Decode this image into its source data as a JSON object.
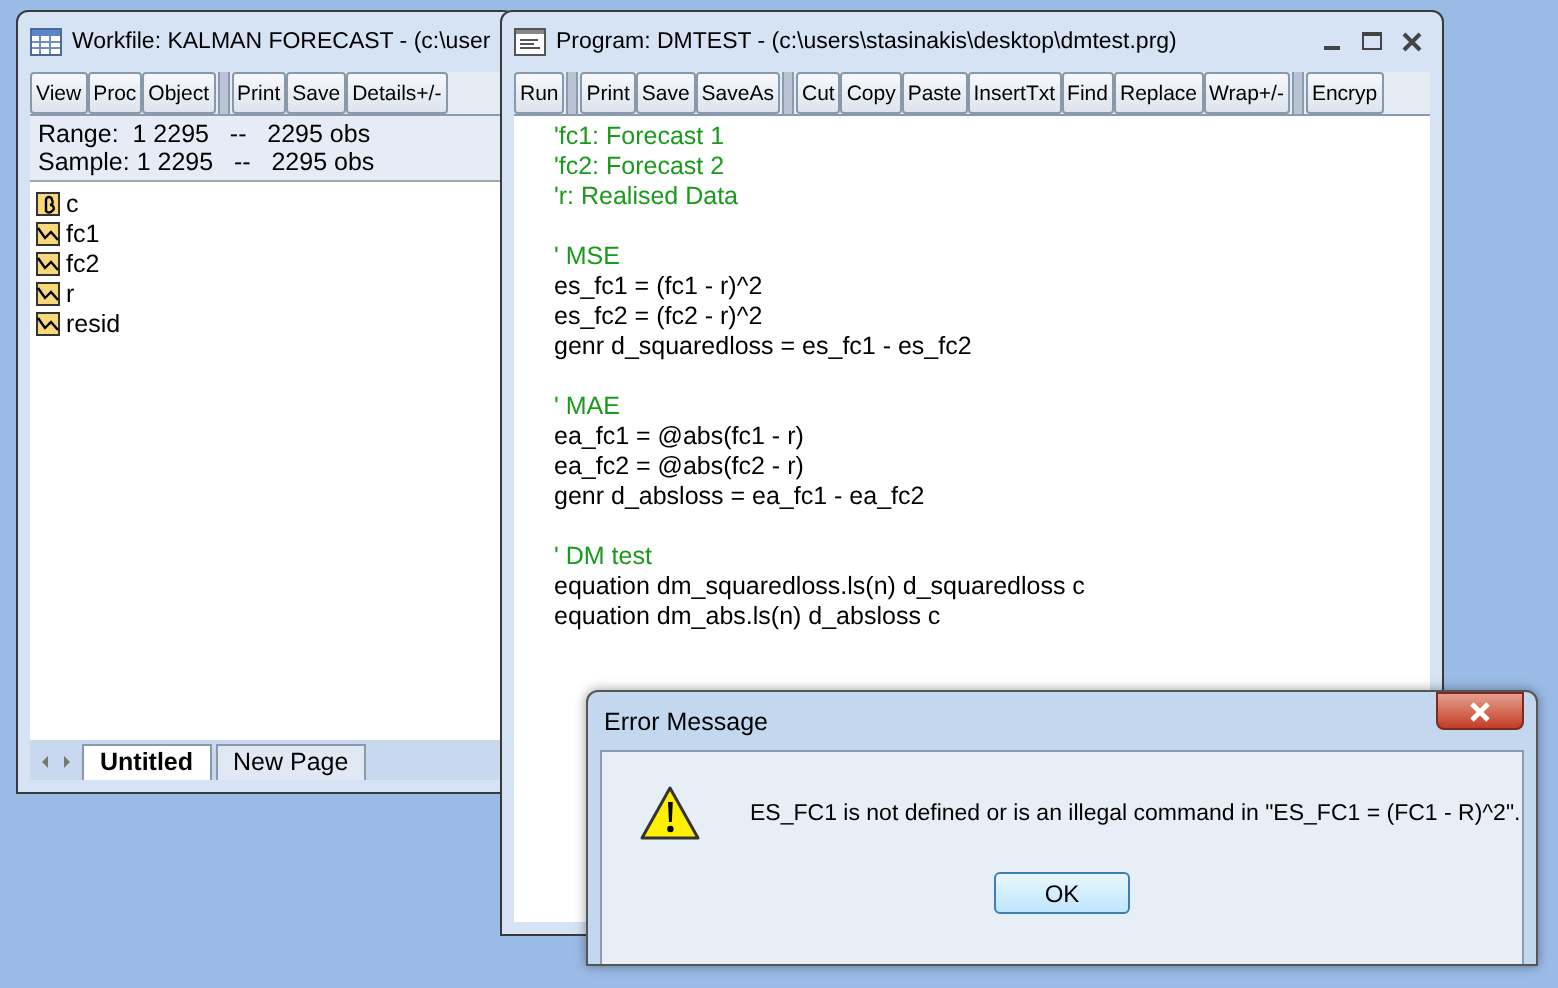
{
  "workfile": {
    "title": "Workfile: KALMAN FORECAST - (c:\\user",
    "toolbar": [
      [
        "View",
        "Proc",
        "Object"
      ],
      [
        "Print",
        "Save",
        "Details+/-"
      ]
    ],
    "info_lines": [
      "Range:  1 2295   --   2295 obs",
      "Sample: 1 2295   --   2295 obs"
    ],
    "items": [
      {
        "name": "c",
        "kind": "coefficient"
      },
      {
        "name": "fc1",
        "kind": "series"
      },
      {
        "name": "fc2",
        "kind": "series"
      },
      {
        "name": "r",
        "kind": "series"
      },
      {
        "name": "resid",
        "kind": "series"
      }
    ],
    "tabs": [
      {
        "label": "Untitled",
        "selected": true
      },
      {
        "label": "New Page",
        "selected": false
      }
    ]
  },
  "program": {
    "title": "Program: DMTEST - (c:\\users\\stasinakis\\desktop\\dmtest.prg)",
    "toolbar": [
      [
        "Run"
      ],
      [
        "Print",
        "Save",
        "SaveAs"
      ],
      [
        "Cut",
        "Copy",
        "Paste",
        "InsertTxt",
        "Find",
        "Replace",
        "Wrap+/-"
      ],
      [
        "Encryp"
      ]
    ],
    "lines": [
      {
        "kind": "comment",
        "text": "'fc1: Forecast 1"
      },
      {
        "kind": "comment",
        "text": "'fc2: Forecast 2"
      },
      {
        "kind": "comment",
        "text": "'r: Realised Data"
      },
      {
        "kind": "blank"
      },
      {
        "kind": "comment",
        "text": "' MSE"
      },
      {
        "kind": "code",
        "text": "es_fc1 = (fc1 - r)^2"
      },
      {
        "kind": "code",
        "text": "es_fc2 = (fc2 - r)^2"
      },
      {
        "kind": "code",
        "text": "genr d_squaredloss = es_fc1 - es_fc2"
      },
      {
        "kind": "blank"
      },
      {
        "kind": "comment",
        "text": "' MAE"
      },
      {
        "kind": "code",
        "text": "ea_fc1 = @abs(fc1 - r)"
      },
      {
        "kind": "code",
        "text": "ea_fc2 = @abs(fc2 - r)"
      },
      {
        "kind": "code",
        "text": "genr d_absloss = ea_fc1 - ea_fc2"
      },
      {
        "kind": "blank"
      },
      {
        "kind": "comment",
        "text": "' DM test"
      },
      {
        "kind": "code",
        "text": "equation dm_squaredloss.ls(n) d_squaredloss c"
      },
      {
        "kind": "code",
        "text": "equation dm_abs.ls(n) d_absloss c"
      }
    ]
  },
  "dialog": {
    "title": "Error Message",
    "message": "ES_FC1 is not defined or is an illegal command in \"ES_FC1 = (FC1 - R)^2\".",
    "button": "OK"
  }
}
